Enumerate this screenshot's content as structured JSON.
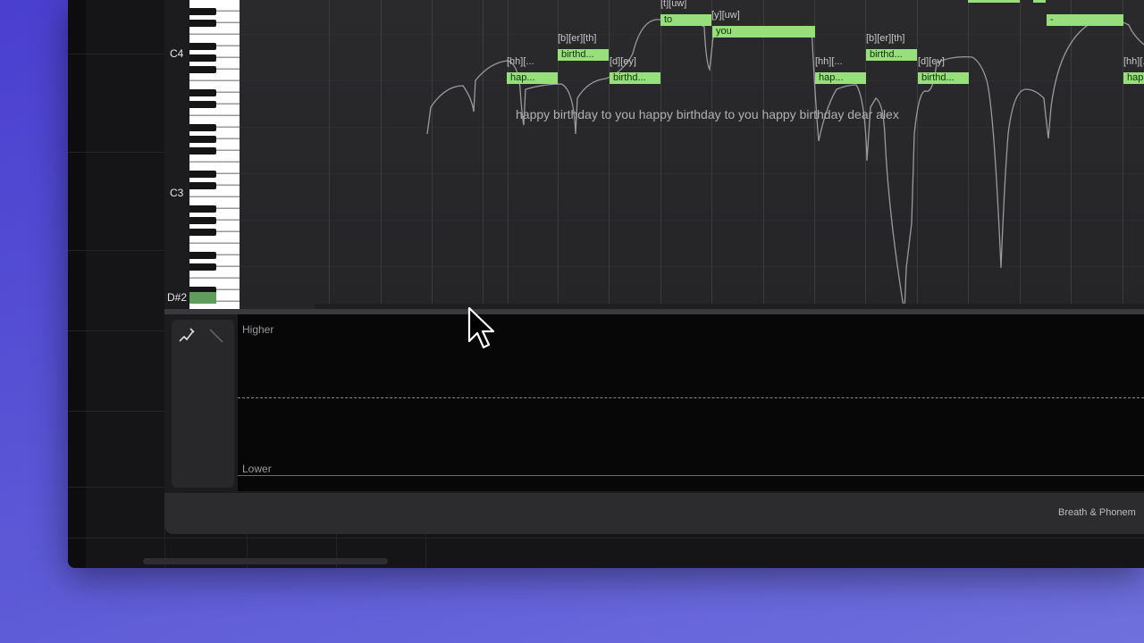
{
  "piano": {
    "labels": [
      "C4",
      "C3",
      "D#2"
    ]
  },
  "notes": [
    {
      "id": "hap-1",
      "lyric": "hap...",
      "phonemes": "[hh][..."
    },
    {
      "id": "birthd-1",
      "lyric": "birthd...",
      "phonemes": "[b][er][th]"
    },
    {
      "id": "birthd-2",
      "lyric": "birthd...",
      "phonemes": "[d][ey]"
    },
    {
      "id": "to",
      "lyric": "to",
      "phonemes": "[t][uw]"
    },
    {
      "id": "you",
      "lyric": "you",
      "phonemes": "[y][uw]"
    },
    {
      "id": "hap-2",
      "lyric": "hap...",
      "phonemes": "[hh][..."
    },
    {
      "id": "birthd-3",
      "lyric": "birthd...",
      "phonemes": "[b][er][th]"
    },
    {
      "id": "birthd-4",
      "lyric": "birthd...",
      "phonemes": "[d][ey]"
    },
    {
      "id": "dash",
      "lyric": "-",
      "phonemes": ""
    },
    {
      "id": "hap-3",
      "lyric": "hap...",
      "phonemes": "[hh][..."
    }
  ],
  "lyrics_line": "happy birthday to you happy birthday to you happy birthday dear alex",
  "param_panel": {
    "higher_label": "Higher",
    "lower_label": "Lower"
  },
  "tools": [
    {
      "name": "draw-curve-icon"
    },
    {
      "name": "line-tool-icon"
    }
  ],
  "footer": {
    "tab_label": "Breath & Phonem"
  },
  "colors": {
    "note_fill": "#97df7a",
    "background_gradient": "#5b57d6",
    "key_highlight": "#5f9d5c"
  }
}
